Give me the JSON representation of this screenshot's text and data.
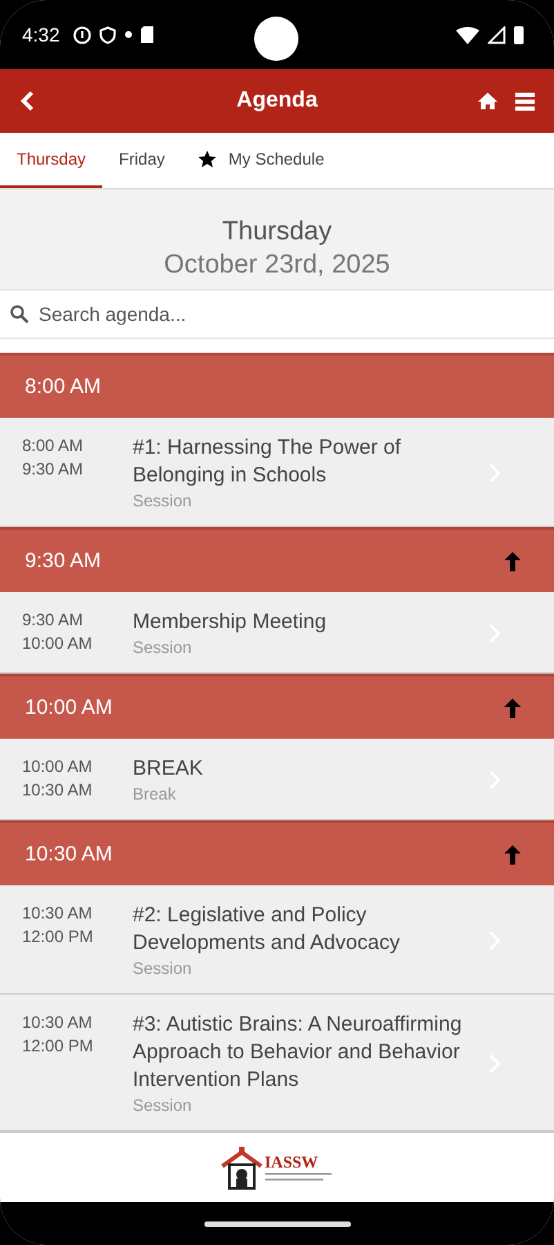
{
  "status_bar": {
    "time": "4:32"
  },
  "header": {
    "title": "Agenda"
  },
  "tabs": [
    {
      "label": "Thursday",
      "selected": true,
      "kind": "text"
    },
    {
      "label": "Friday",
      "selected": false,
      "kind": "text"
    },
    {
      "label": "My Schedule",
      "selected": false,
      "kind": "starred"
    }
  ],
  "day": {
    "weekday": "Thursday",
    "date": "October 23rd, 2025"
  },
  "search": {
    "placeholder": "Search agenda..."
  },
  "groups": [
    {
      "time": "8:00 AM",
      "top_arrow": false,
      "items": [
        {
          "start": "8:00 AM",
          "end": "9:30 AM",
          "title": "#1: Harnessing The Power of Belonging in Schools",
          "type": "Session"
        }
      ]
    },
    {
      "time": "9:30 AM",
      "top_arrow": true,
      "items": [
        {
          "start": "9:30 AM",
          "end": "10:00 AM",
          "title": "Membership Meeting",
          "type": "Session"
        }
      ]
    },
    {
      "time": "10:00 AM",
      "top_arrow": true,
      "items": [
        {
          "start": "10:00 AM",
          "end": "10:30 AM",
          "title": "BREAK",
          "type": "Break"
        }
      ]
    },
    {
      "time": "10:30 AM",
      "top_arrow": true,
      "items": [
        {
          "start": "10:30 AM",
          "end": "12:00 PM",
          "title": "#2: Legislative and Policy Developments and Advocacy",
          "type": "Session"
        },
        {
          "start": "10:30 AM",
          "end": "12:00 PM",
          "title": "#3: Autistic Brains: A Neuroaffirming Approach to Behavior and Behavior Intervention Plans",
          "type": "Session"
        }
      ]
    }
  ],
  "footer": {
    "logo_text": "IASSW"
  }
}
